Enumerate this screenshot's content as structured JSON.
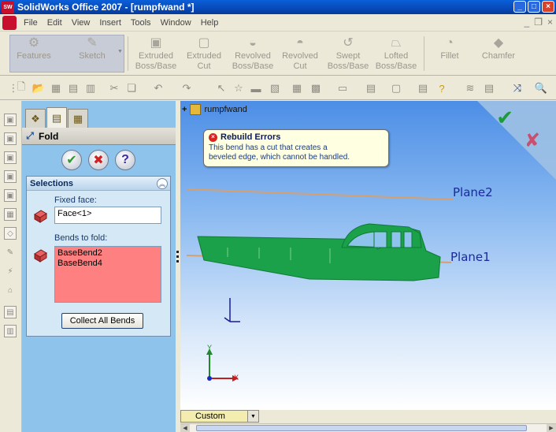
{
  "window": {
    "title": "SolidWorks Office 2007 - [rumpfwand *]",
    "app_icon_text": "SW"
  },
  "menu": {
    "items": [
      "File",
      "Edit",
      "View",
      "Insert",
      "Tools",
      "Window",
      "Help"
    ]
  },
  "features_toolbar": {
    "features_label": "Features",
    "sketch_label": "Sketch",
    "extruded_boss": "Extruded Boss/Base",
    "extruded_cut": "Extruded Cut",
    "revolved_boss": "Revolved Boss/Base",
    "revolved_cut": "Revolved Cut",
    "swept_boss": "Swept Boss/Base",
    "lofted_boss": "Lofted Boss/Base",
    "fillet": "Fillet",
    "chamfer": "Chamfer"
  },
  "property_manager": {
    "title": "Fold",
    "selections_title": "Selections",
    "fixed_face_label": "Fixed face:",
    "fixed_face_value": "Face<1>",
    "bends_label": "Bends to fold:",
    "bends": [
      "BaseBend2",
      "BaseBend4"
    ],
    "collect_button": "Collect All Bends"
  },
  "graphics": {
    "tree_root": "rumpfwand",
    "plane1": "Plane1",
    "plane2": "Plane2",
    "triad_x": "X",
    "triad_y": "Y",
    "model_color": "#1BA14A"
  },
  "tooltip": {
    "title": "Rebuild Errors",
    "line1": "This bend has a cut that creates a",
    "line2": "beveled edge, which cannot be handled."
  },
  "view_selector": {
    "value": "Custom"
  },
  "colors": {
    "panel_blue": "#8EC4EC",
    "error_list": "#FF8080",
    "ok_green": "#2E9A2E",
    "cancel_red": "#D02020"
  }
}
